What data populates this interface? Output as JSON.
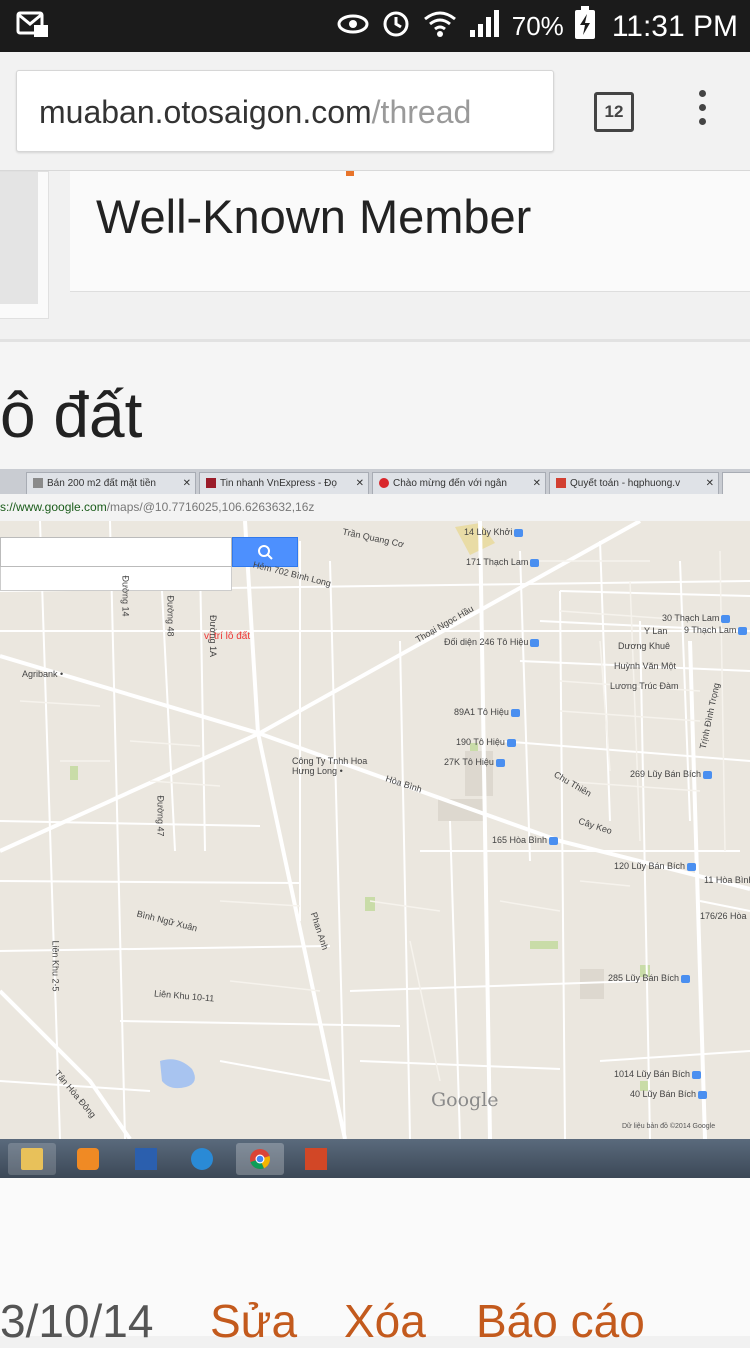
{
  "status_bar": {
    "left_icon": "message-icon",
    "icons": [
      "eye-icon",
      "alarm-icon",
      "wifi-icon",
      "signal-icon"
    ],
    "battery_percent": "70%",
    "battery_icon": "battery-charging-icon",
    "time": "11:31 PM"
  },
  "browser": {
    "url_host": "muaban.otosaigon.com",
    "url_path": "/thread",
    "tab_count": "12",
    "menu_icon": "overflow-menu-icon"
  },
  "post": {
    "member_title": "Well-Known Member",
    "title_fragment": "ô đất",
    "footer": {
      "date": "3/10/14",
      "edit": "Sửa",
      "delete": "Xóa",
      "report": "Báo cáo"
    }
  },
  "screenshot": {
    "tabs": [
      {
        "label": "Bán 200 m2 đất mặt tiền",
        "favicon_color": "#8a8a8a"
      },
      {
        "label": "Tin nhanh VnExpress - Đọ",
        "favicon_color": "#9b1c2a"
      },
      {
        "label": "Chào mừng đến với ngân",
        "favicon_color": "#d9262b"
      },
      {
        "label": "Quyết toán - hqphuong.v",
        "favicon_color": "#d23f31"
      }
    ],
    "address_host": "s://www.google.com",
    "address_path": "/maps/@10.7716025,106.6263632,16z",
    "map": {
      "search_icon": "search-icon",
      "marker_label": "vị trí lô đất",
      "streets": [
        "Trần Quang Cơ",
        "Hẻm 702 Bình Long",
        "Thoại Ngọc Hầu",
        "Hòa Bình",
        "Phan Anh",
        "Bình Ngữ Xuân",
        "Liên Khu 10-11",
        "Tân Hòa Đông",
        "Liên Khu 2-5",
        "Đường 47",
        "Đường 14",
        "Đường 48",
        "Đường 1A",
        "Chu Thiên",
        "Cây Keo",
        "Dương Khuê",
        "Huỳnh Văn Một",
        "Lương Trúc Đàm",
        "Y Lan",
        "Trịnh Đình Trọng"
      ],
      "place_labels": [
        "Agribank",
        "Công Ty Tnhh Hoa Hưng Long",
        "14 Lũy Khởi",
        "171 Thạch Lam",
        "30 Thạch Lam",
        "9 Thạch Lam",
        "Đối diện 246 Tô Hiệu",
        "89A1 Tô Hiệu",
        "190 Tô Hiệu",
        "27K Tô Hiệu",
        "269 Lũy Bán Bích",
        "165 Hòa Bình",
        "120 Lũy Bán Bích",
        "11 Hòa Bình",
        "176/26 Hòa",
        "285 Lũy Bán Bích",
        "1014 Lũy Bán Bích",
        "40 Lũy Bán Bích"
      ],
      "logo": "Google",
      "copyright": "Dữ liệu bản đồ ©2014 Google"
    },
    "taskbar": [
      {
        "icon": "file-explorer-icon",
        "color": "#e8c15a"
      },
      {
        "icon": "media-player-icon",
        "color": "#f08a24"
      },
      {
        "icon": "word-icon",
        "color": "#2b5fae"
      },
      {
        "icon": "internet-explorer-icon",
        "color": "#2a8ad6"
      },
      {
        "icon": "chrome-icon",
        "color": "#4a9a3c"
      },
      {
        "icon": "powerpoint-icon",
        "color": "#d24726"
      }
    ]
  }
}
